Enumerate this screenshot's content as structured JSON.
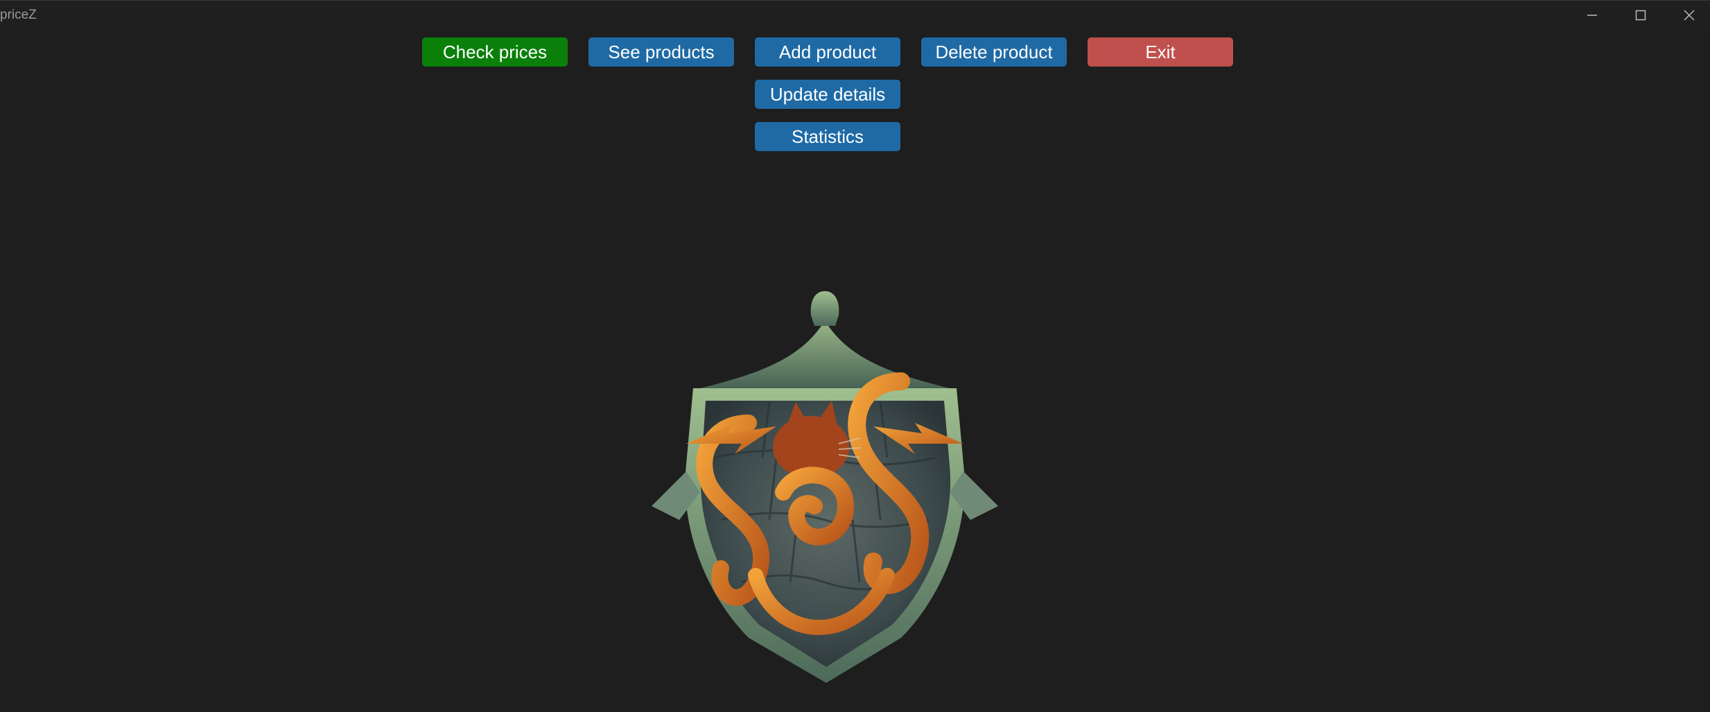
{
  "window": {
    "title": "priceZ",
    "controls": {
      "minimize": "minimize-icon",
      "maximize": "maximize-icon",
      "close": "close-icon"
    }
  },
  "toolbar": {
    "check_prices": "Check prices",
    "see_products": "See products",
    "add_product": "Add product",
    "delete_product": "Delete product",
    "exit": "Exit",
    "update_details": "Update details",
    "statistics": "Statistics"
  },
  "colors": {
    "background": "#1e1e1e",
    "button_blue": "#1f6aa5",
    "button_green": "#0a7f0a",
    "button_red": "#c0504d"
  },
  "main": {
    "emblem_icon": "shield-cat-emblem-icon"
  }
}
